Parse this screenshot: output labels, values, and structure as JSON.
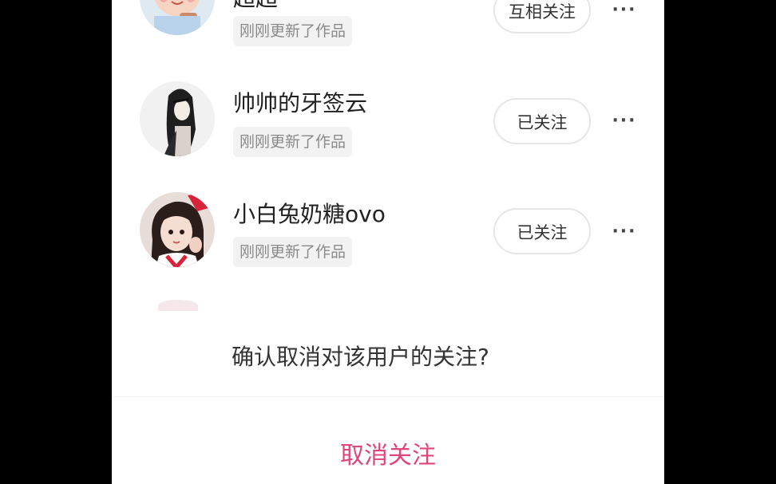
{
  "follow_list": [
    {
      "name": "超超",
      "status_tag": "刚刚更新了作品",
      "button_label": "互相关注",
      "more_label": "···",
      "avatar_icon": "cartoon-baby-avatar"
    },
    {
      "name": "帅帅的牙签云",
      "status_tag": "刚刚更新了作品",
      "button_label": "已关注",
      "more_label": "···",
      "avatar_icon": "ink-portrait-avatar"
    },
    {
      "name": "小白兔奶糖ovo",
      "status_tag": "刚刚更新了作品",
      "button_label": "已关注",
      "more_label": "···",
      "avatar_icon": "girl-photo-avatar"
    }
  ],
  "dialog": {
    "message": "确认取消对该用户的关注?",
    "confirm_label": "取消关注"
  },
  "colors": {
    "accent": "#e0457a",
    "tag_bg": "#f2f2f2",
    "tag_text": "#8a8a8a"
  }
}
